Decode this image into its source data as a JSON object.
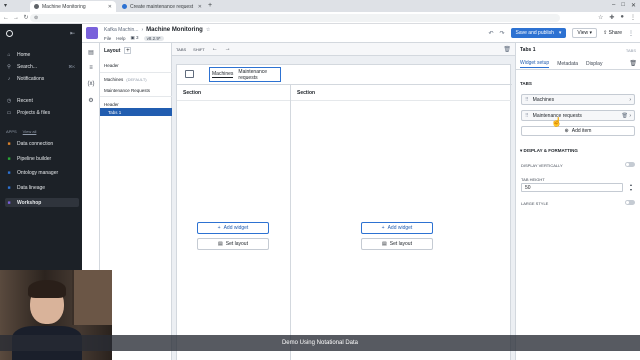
{
  "browser": {
    "tabs": [
      {
        "label": "Machine Monitoring",
        "active": true
      },
      {
        "label": "Create maintenance request",
        "active": false
      }
    ],
    "new_tab": "+",
    "url": ""
  },
  "sidebar": {
    "items_top": [
      {
        "label": "Home",
        "icon": "home-icon"
      },
      {
        "label": "Search...",
        "icon": "search-icon",
        "shortcut": "⌘K"
      },
      {
        "label": "Notifications",
        "icon": "bell-icon"
      }
    ],
    "items_mid": [
      {
        "label": "Recent",
        "icon": "clock-icon"
      },
      {
        "label": "Projects & files",
        "icon": "folder-icon"
      }
    ],
    "apps_header": "APPS",
    "view_all": "View all",
    "apps": [
      {
        "label": "Data connection",
        "color": "#d9822b"
      },
      {
        "label": "Pipeline builder",
        "color": "#29a634"
      },
      {
        "label": "Ontology manager",
        "color": "#2d72d2"
      },
      {
        "label": "Data lineage",
        "color": "#2d72d2"
      },
      {
        "label": "Workshop",
        "color": "#7961db",
        "active": true
      }
    ]
  },
  "header": {
    "parent": "Kafka Machin...",
    "title": "Machine Monitoring",
    "menus": [
      "File",
      "Help"
    ],
    "count": "3",
    "version": "v8.2.9*",
    "save_label": "Save and publish",
    "view_label": "View",
    "share_label": "Share"
  },
  "layout_panel": {
    "title": "Layout",
    "rows": [
      {
        "label": "Header",
        "muted": ""
      },
      {
        "label": "Machines",
        "muted": "(DEFAULT)"
      },
      {
        "label": "Maintenance Requests",
        "muted": ""
      },
      {
        "label": "Header",
        "muted": ""
      },
      {
        "label": "Tabs 1",
        "muted": "",
        "selected": true
      }
    ]
  },
  "canvas": {
    "toolbar": [
      "TABS",
      "SHIFT"
    ],
    "tabs_widget": [
      "Machines",
      "Maintenance requests"
    ],
    "sections": [
      {
        "title": "Section",
        "add_widget": "Add widget",
        "set_layout": "Set layout"
      },
      {
        "title": "Section",
        "add_widget": "Add widget",
        "set_layout": "Set layout"
      }
    ]
  },
  "right_panel": {
    "title": "Tabs 1",
    "title_right": "TABS",
    "tabs": [
      "Widget setup",
      "Metadata",
      "Display"
    ],
    "tabs_section": "TABS",
    "tab_items": [
      "Machines",
      "Maintenance requests"
    ],
    "add_item": "Add item",
    "display_section": "DISPLAY & FORMATTING",
    "display_vertically": "DISPLAY VERTICALLY",
    "tab_height_label": "TAB HEIGHT",
    "tab_height_value": "50",
    "large_style": "LARGE STYLE"
  },
  "caption": "Demo Using Notational Data"
}
